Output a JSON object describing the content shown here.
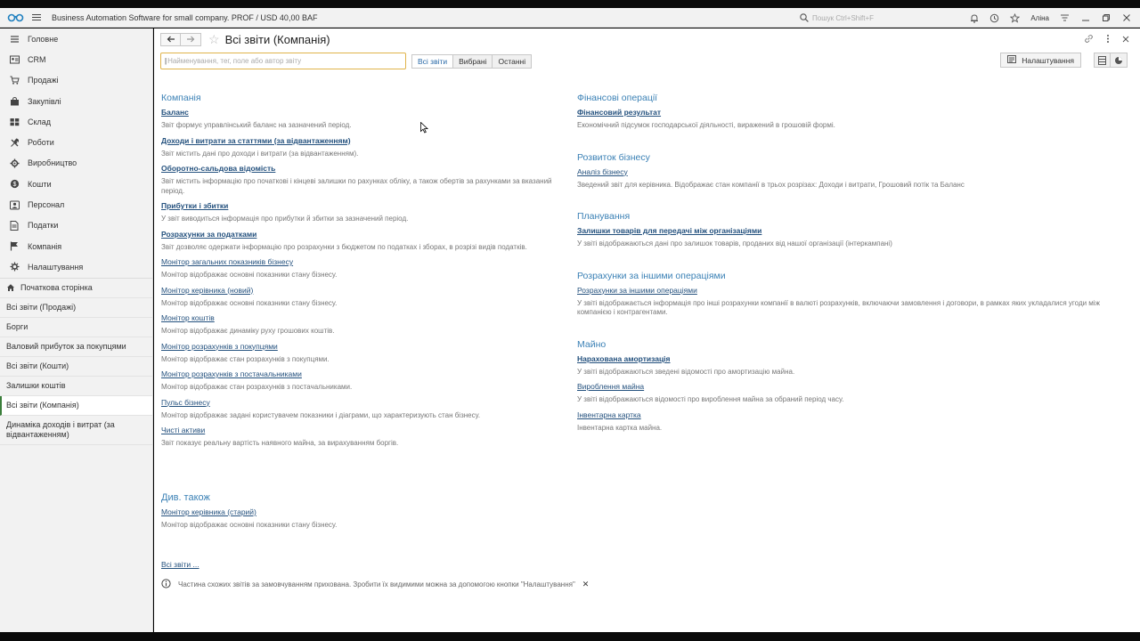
{
  "window": {
    "title": "Business Automation Software for small company. PROF / USD 40,00 BAF",
    "search_placeholder": "Пошук Ctrl+Shift+F",
    "username": "Аліна"
  },
  "sidebar": {
    "sections": [
      {
        "label": "Головне",
        "icon": "menu-icon"
      },
      {
        "label": "CRM",
        "icon": "crm-icon"
      },
      {
        "label": "Продажі",
        "icon": "sales-icon"
      },
      {
        "label": "Закупівлі",
        "icon": "purchases-icon"
      },
      {
        "label": "Склад",
        "icon": "warehouse-icon"
      },
      {
        "label": "Роботи",
        "icon": "tools-icon"
      },
      {
        "label": "Виробництво",
        "icon": "production-icon"
      },
      {
        "label": "Кошти",
        "icon": "money-icon"
      },
      {
        "label": "Персонал",
        "icon": "person-icon"
      },
      {
        "label": "Податки",
        "icon": "tax-icon"
      },
      {
        "label": "Компанія",
        "icon": "flag-icon"
      },
      {
        "label": "Налаштування",
        "icon": "gear-icon"
      }
    ],
    "home_label": "Початкова сторінка",
    "open_windows": [
      "Всі звіти (Продажі)",
      "Борги",
      "Валовий прибуток за покупцями",
      "Всі звіти (Кошти)",
      "Залишки коштів",
      "Всі звіти (Компанія)",
      "Динаміка доходів і витрат (за відвантаженням)"
    ]
  },
  "page": {
    "title": "Всі звіти (Компанія)",
    "filter_placeholder": "Найменування, тег, поле або автор звіту",
    "filters": [
      "Всі звіти",
      "Вибрані",
      "Останні"
    ],
    "settings_label": "Налаштування"
  },
  "left_column": [
    {
      "group": "Компанія",
      "reports": [
        {
          "name": "Баланс",
          "bold": true,
          "desc": "Звіт формує управлінський баланс на зазначений період."
        },
        {
          "name": "Доходи і витрати за статтями (за відвантаженням)",
          "bold": true,
          "desc": "Звіт містить дані про доходи і витрати (за відвантаженням)."
        },
        {
          "name": "Оборотно-сальдова відомість",
          "bold": true,
          "desc": "Звіт містить інформацію про початкові і кінцеві залишки по рахунках обліку, а також обертів за рахунками за вказаний період."
        },
        {
          "name": "Прибутки і збитки",
          "bold": true,
          "desc": "У звіт виводиться інформація про прибутки й збитки за зазначений період."
        },
        {
          "name": "Розрахунки за податками",
          "bold": true,
          "desc": "Звіт дозволяє одержати інформацію про розрахунки з бюджетом по податках і зборах, в розрізі видів податків."
        },
        {
          "name": "Монітор загальних показників бізнесу",
          "bold": false,
          "desc": "Монітор відображає основні показники стану бізнесу."
        },
        {
          "name": "Монітор керівника (новий)",
          "bold": false,
          "desc": "Монітор відображає основні показники стану бізнесу."
        },
        {
          "name": "Монітор коштів",
          "bold": false,
          "desc": "Монітор відображає динаміку руху грошових коштів."
        },
        {
          "name": "Монітор розрахунків з покупцями",
          "bold": false,
          "desc": "Монітор відображає стан розрахунків з покупцями."
        },
        {
          "name": "Монітор розрахунків з постачальниками",
          "bold": false,
          "desc": "Монітор відображає стан розрахунків з постачальниками."
        },
        {
          "name": "Пульс бізнесу",
          "bold": false,
          "desc": "Монітор відображає задані користувачем показники і діаграми, що характеризують стан бізнесу."
        },
        {
          "name": "Чисті активи",
          "bold": false,
          "desc": "Звіт показує реальну вартість наявного майна, за вирахуванням боргів."
        }
      ]
    }
  ],
  "right_column": [
    {
      "group": "Фінансові операції",
      "reports": [
        {
          "name": "Фінансовий результат",
          "bold": true,
          "desc": "Економічний підсумок господарської діяльності, виражений в грошовій формі."
        }
      ]
    },
    {
      "group": "Розвиток бізнесу",
      "reports": [
        {
          "name": "Аналіз бізнесу",
          "bold": false,
          "desc": "Зведений звіт для керівника. Відображає стан компанії в трьох розрізах: Доходи і витрати, Грошовий потік та Баланс"
        }
      ]
    },
    {
      "group": "Планування",
      "reports": [
        {
          "name": "Залишки товарів для передачі між організаціями",
          "bold": true,
          "desc": "У звіті відображаються дані про залишок товарів, проданих від нашої організації (інтеркампані)"
        }
      ]
    },
    {
      "group": "Розрахунки за іншими операціями",
      "reports": [
        {
          "name": "Розрахунки за іншими операціями",
          "bold": false,
          "desc": "У звіті відображається інформація про інші розрахунки компанії в валюті розрахунків, включаючи замовлення і договори, в рамках яких укладалися угоди між компанією і контрагентами."
        }
      ]
    },
    {
      "group": "Майно",
      "reports": [
        {
          "name": "Нарахована амортизація",
          "bold": true,
          "desc": "У звіті відображаються зведені відомості про амортизацію майна."
        },
        {
          "name": "Вироблення майна",
          "bold": false,
          "desc": "У звіті відображаються відомості про вироблення майна за обраний період часу."
        },
        {
          "name": "Інвентарна картка",
          "bold": false,
          "desc": "Інвентарна картка майна."
        }
      ]
    }
  ],
  "see_also": {
    "title": "Див. також",
    "reports": [
      {
        "name": "Монітор керівника (старий)",
        "desc": "Монітор відображає основні показники стану бізнесу."
      }
    ]
  },
  "all_reports_link": "Всі звіти ...",
  "info_message": "Частина схожих звітів за замовчуванням прихована. Зробити їх видимими можна за допомогою кнопки \"Налаштування\"",
  "colors": {
    "group_heading": "#3a80b5",
    "link": "#24517e",
    "active_marker": "#3b7e3b",
    "input_border": "#e0b34a"
  }
}
